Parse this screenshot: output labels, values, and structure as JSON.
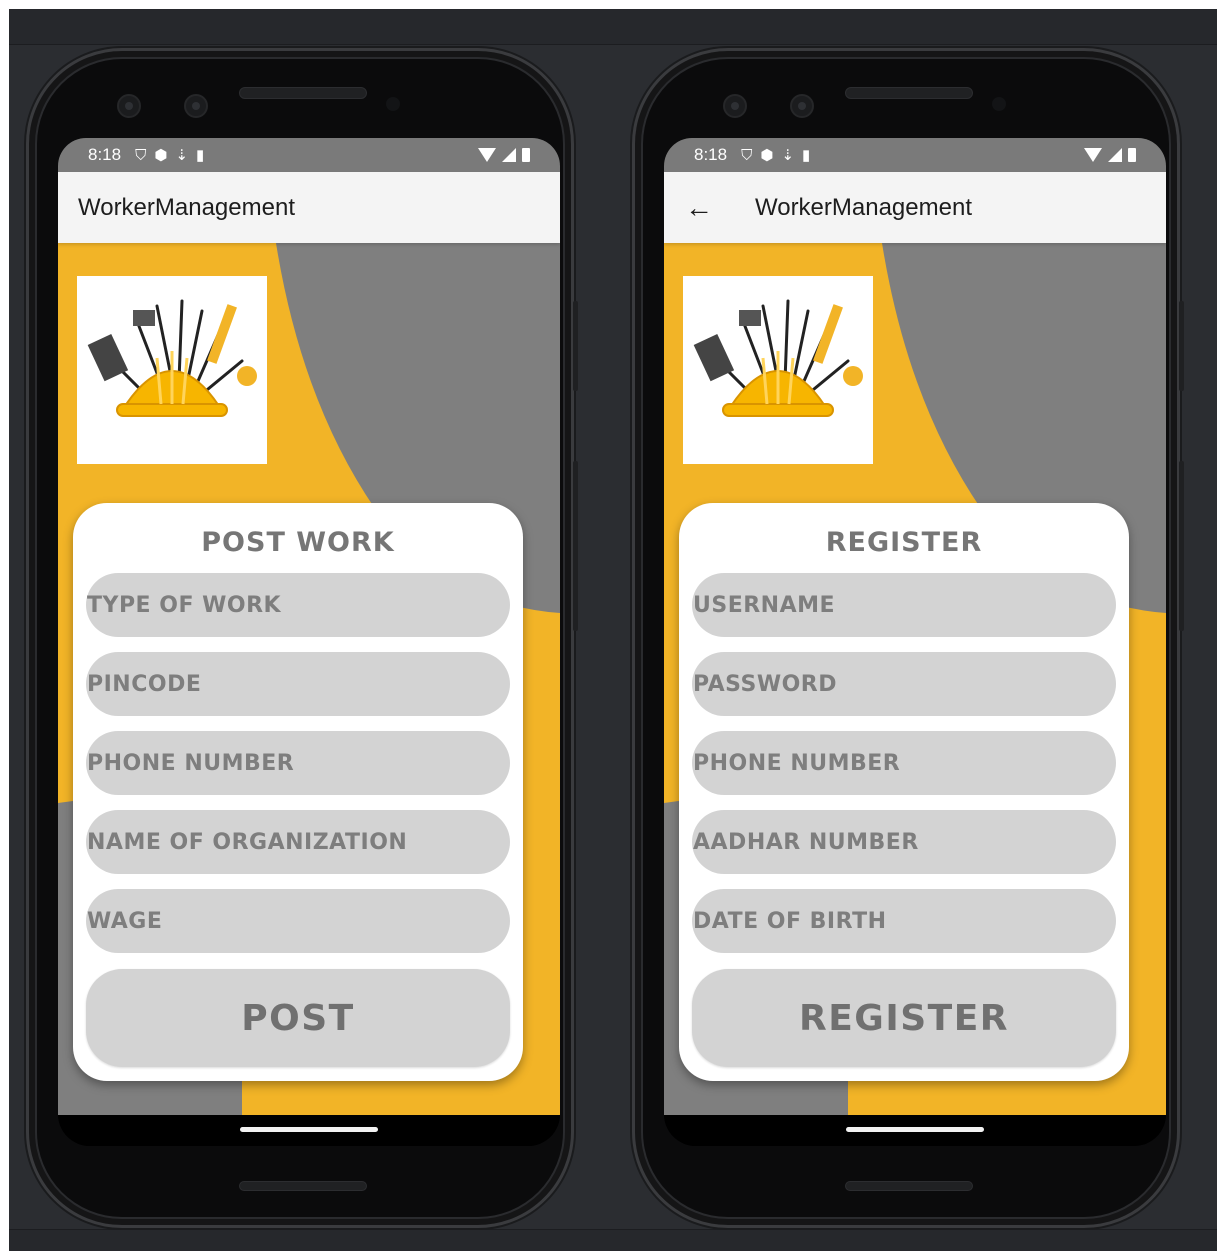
{
  "screens": [
    {
      "status": {
        "time": "8:18"
      },
      "appbar": {
        "title": "WorkerManagement",
        "has_back": false
      },
      "form": {
        "title": "POST WORK",
        "fields": [
          "TYPE OF WORK",
          "PINCODE",
          "PHONE NUMBER",
          "NAME OF ORGANIZATION",
          "WAGE"
        ],
        "button": "POST"
      }
    },
    {
      "status": {
        "time": "8:18"
      },
      "appbar": {
        "title": "WorkerManagement",
        "has_back": true,
        "back_icon": "arrow-left-icon"
      },
      "form": {
        "title": "REGISTER",
        "fields": [
          "USERNAME",
          "PASSWORD",
          "PHONE NUMBER",
          "AADHAR NUMBER",
          "DATE OF BIRTH"
        ],
        "button": "REGISTER"
      }
    }
  ],
  "colors": {
    "accent_yellow": "#f2b427",
    "shape_gray": "#7f7f7f",
    "field_gray": "#d3d3d3",
    "text_gray": "#7e7e7e"
  }
}
